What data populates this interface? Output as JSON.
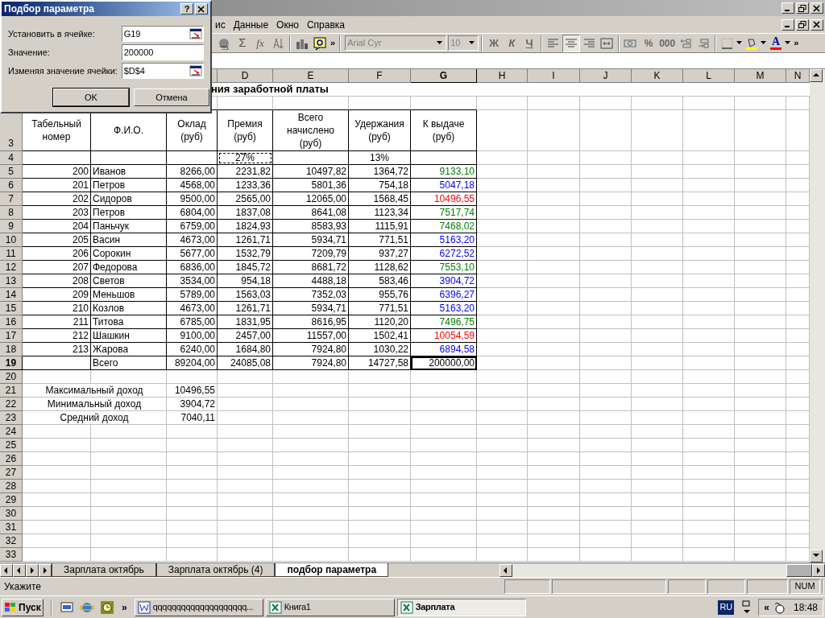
{
  "dialog": {
    "title": "Подбор параметра",
    "help": "?",
    "fields": [
      {
        "label": "Установить в ячейке:",
        "value": "G19",
        "kind": "reference"
      },
      {
        "label": "Значение:",
        "value": "200000",
        "kind": "number"
      },
      {
        "label": "Изменяя значение ячейки:",
        "value": "$D$4",
        "kind": "reference"
      }
    ],
    "buttons": [
      {
        "label": "OK",
        "default": true
      },
      {
        "label": "Отмена",
        "default": false
      }
    ]
  },
  "menu": [
    "ис",
    "Данные",
    "Окно",
    "Справка"
  ],
  "toolbar": {
    "autosum": "Σ",
    "function": "fx",
    "more_left": "»",
    "font": "Arial Cyr",
    "size": "10",
    "styles": [
      "Ж",
      "К",
      "Ч"
    ],
    "align": [
      {
        "kind": "left",
        "selected": false
      },
      {
        "kind": "center",
        "selected": true
      },
      {
        "kind": "right",
        "selected": false
      },
      {
        "kind": "merge",
        "selected": false
      }
    ],
    "number_formats": [
      "%",
      "000"
    ],
    "font_color": "A",
    "more_right": "»"
  },
  "sheet": {
    "title": "ния заработной платы",
    "columns": [
      {
        "letter": "D",
        "selected": false
      },
      {
        "letter": "E",
        "selected": false
      },
      {
        "letter": "F",
        "selected": false
      },
      {
        "letter": "G",
        "selected": true
      },
      {
        "letter": "H",
        "selected": false
      },
      {
        "letter": "I",
        "selected": false
      },
      {
        "letter": "J",
        "selected": false
      },
      {
        "letter": "K",
        "selected": false
      },
      {
        "letter": "L",
        "selected": false
      },
      {
        "letter": "M",
        "selected": false
      },
      {
        "letter": "N",
        "selected": false
      }
    ],
    "rows": [
      {
        "number": "3",
        "kind": "header",
        "selected": false,
        "cells": {
          "a": "Табельный\nномер",
          "b": "Ф.И.О.",
          "c": "Оклад\n(руб)",
          "d": "Премия\n(руб)",
          "e": "Всего\nначислено\n(руб)",
          "f": "Удержания\n(руб)",
          "g": "К выдаче\n(руб)"
        }
      },
      {
        "number": "4",
        "kind": "percent",
        "selected": false,
        "cells": {
          "d": {
            "text": "27%",
            "marquee": true
          },
          "f": "13%"
        }
      },
      {
        "number": "5",
        "kind": "data",
        "selected": false,
        "cells": {
          "a": "200",
          "b": "Иванов",
          "c": "8266,00",
          "d": "2231,82",
          "e": "10497,82",
          "f": "1364,72",
          "g": {
            "text": "9133,10",
            "color": "#008000"
          }
        }
      },
      {
        "number": "6",
        "kind": "data",
        "selected": false,
        "cells": {
          "a": "201",
          "b": "Петров",
          "c": "4568,00",
          "d": "1233,36",
          "e": "5801,36",
          "f": "754,18",
          "g": {
            "text": "5047,18",
            "color": "#0000ff"
          }
        }
      },
      {
        "number": "7",
        "kind": "data",
        "selected": false,
        "cells": {
          "a": "202",
          "b": "Сидоров",
          "c": "9500,00",
          "d": "2565,00",
          "e": "12065,00",
          "f": "1568,45",
          "g": {
            "text": "10496,55",
            "color": "#ff0000"
          }
        }
      },
      {
        "number": "8",
        "kind": "data",
        "selected": false,
        "cells": {
          "a": "203",
          "b": "Петров",
          "c": "6804,00",
          "d": "1837,08",
          "e": "8641,08",
          "f": "1123,34",
          "g": {
            "text": "7517,74",
            "color": "#008000"
          }
        }
      },
      {
        "number": "9",
        "kind": "data",
        "selected": false,
        "cells": {
          "a": "204",
          "b": "Паньчук",
          "c": "6759,00",
          "d": "1824,93",
          "e": "8583,93",
          "f": "1115,91",
          "g": {
            "text": "7468,02",
            "color": "#008000"
          }
        }
      },
      {
        "number": "10",
        "kind": "data",
        "selected": false,
        "cells": {
          "a": "205",
          "b": "Васин",
          "c": "4673,00",
          "d": "1261,71",
          "e": "5934,71",
          "f": "771,51",
          "g": {
            "text": "5163,20",
            "color": "#0000ff"
          }
        }
      },
      {
        "number": "11",
        "kind": "data",
        "selected": false,
        "cells": {
          "a": "206",
          "b": "Сорокин",
          "c": "5677,00",
          "d": "1532,79",
          "e": "7209,79",
          "f": "937,27",
          "g": {
            "text": "6272,52",
            "color": "#0000ff"
          }
        }
      },
      {
        "number": "12",
        "kind": "data",
        "selected": false,
        "cells": {
          "a": "207",
          "b": "Федорова",
          "c": "6836,00",
          "d": "1845,72",
          "e": "8681,72",
          "f": "1128,62",
          "g": {
            "text": "7553,10",
            "color": "#008000"
          }
        }
      },
      {
        "number": "13",
        "kind": "data",
        "selected": false,
        "cells": {
          "a": "208",
          "b": "Светов",
          "c": "3534,00",
          "d": "954,18",
          "e": "4488,18",
          "f": "583,46",
          "g": {
            "text": "3904,72",
            "color": "#0000ff"
          }
        }
      },
      {
        "number": "14",
        "kind": "data",
        "selected": false,
        "cells": {
          "a": "209",
          "b": "Меньшов",
          "c": "5789,00",
          "d": "1563,03",
          "e": "7352,03",
          "f": "955,76",
          "g": {
            "text": "6396,27",
            "color": "#0000ff"
          }
        }
      },
      {
        "number": "15",
        "kind": "data",
        "selected": false,
        "cells": {
          "a": "210",
          "b": "Козлов",
          "c": "4673,00",
          "d": "1261,71",
          "e": "5934,71",
          "f": "771,51",
          "g": {
            "text": "5163,20",
            "color": "#0000ff"
          }
        }
      },
      {
        "number": "16",
        "kind": "data",
        "selected": false,
        "cells": {
          "a": "211",
          "b": "Титова",
          "c": "6785,00",
          "d": "1831,95",
          "e": "8616,95",
          "f": "1120,20",
          "g": {
            "text": "7496,75",
            "color": "#008000"
          }
        }
      },
      {
        "number": "17",
        "kind": "data",
        "selected": false,
        "cells": {
          "a": "212",
          "b": "Шашкин",
          "c": "9100,00",
          "d": "2457,00",
          "e": "11557,00",
          "f": "1502,41",
          "g": {
            "text": "10054,59",
            "color": "#ff0000"
          }
        }
      },
      {
        "number": "18",
        "kind": "data",
        "selected": false,
        "cells": {
          "a": "213",
          "b": "Жарова",
          "c": "6240,00",
          "d": "1684,80",
          "e": "7924,80",
          "f": "1030,22",
          "g": {
            "text": "6894,58",
            "color": "#0000ff"
          }
        }
      },
      {
        "number": "19",
        "kind": "total",
        "selected": true,
        "cells": {
          "b": "Всего",
          "c": "89204,00",
          "d": "24085,08",
          "e": "7924,80",
          "f": "14727,58",
          "g": {
            "text": "200000,00",
            "selected": true
          }
        }
      },
      {
        "number": "20",
        "kind": "empty",
        "selected": false
      },
      {
        "number": "21",
        "kind": "summary",
        "selected": false,
        "label": "Максимальный доход",
        "value": "10496,55"
      },
      {
        "number": "22",
        "kind": "summary",
        "selected": false,
        "label": "Минимальный доход",
        "value": "3904,72"
      },
      {
        "number": "23",
        "kind": "summary",
        "selected": false,
        "label": "Средний доход",
        "value": "7040,11"
      },
      {
        "number": "24",
        "kind": "empty",
        "selected": false
      },
      {
        "number": "25",
        "kind": "empty",
        "selected": false
      },
      {
        "number": "26",
        "kind": "empty",
        "selected": false
      },
      {
        "number": "27",
        "kind": "empty",
        "selected": false
      },
      {
        "number": "28",
        "kind": "empty",
        "selected": false
      },
      {
        "number": "29",
        "kind": "empty",
        "selected": false
      },
      {
        "number": "30",
        "kind": "empty",
        "selected": false
      },
      {
        "number": "31",
        "kind": "empty",
        "selected": false
      },
      {
        "number": "32",
        "kind": "empty",
        "selected": false
      },
      {
        "number": "33",
        "kind": "empty",
        "selected": false
      }
    ]
  },
  "sheet_tabs": [
    {
      "label": "Зарплата октябрь",
      "selected": false
    },
    {
      "label": "Зарплата октябрь (4)",
      "selected": false
    },
    {
      "label": "подбор параметра",
      "selected": true
    }
  ],
  "status_bar": {
    "message": "Укажите",
    "num": "NUM"
  },
  "taskbar": {
    "start": "Пуск",
    "more": "»",
    "tasks": [
      {
        "label": "qqqqqqqqqqqqqqqqqqqq...",
        "kind": "word",
        "selected": false
      },
      {
        "label": "Книга1",
        "kind": "excel",
        "selected": false
      },
      {
        "label": "Зарплата",
        "kind": "excel",
        "selected": true
      }
    ],
    "language": "RU",
    "tray_more": "«",
    "clock": "18:48"
  }
}
